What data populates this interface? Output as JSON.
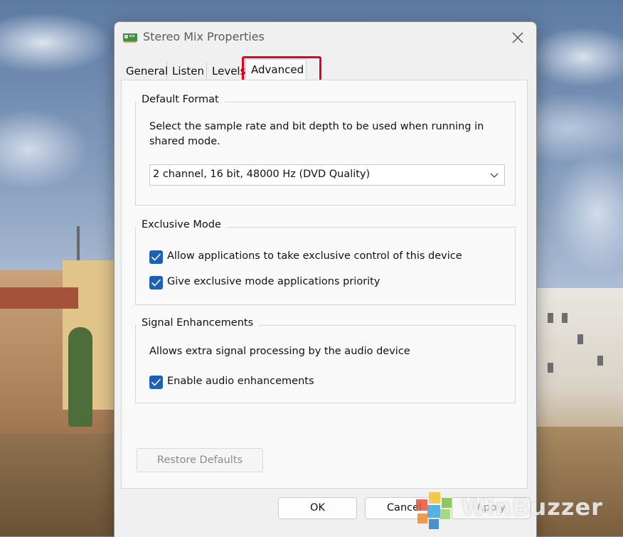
{
  "window": {
    "title": "Stereo Mix Properties",
    "title_icon": "sound-card-icon",
    "close_icon": "close-icon"
  },
  "tabs": [
    {
      "label": "General",
      "active": false
    },
    {
      "label": "Listen",
      "active": false
    },
    {
      "label": "Levels",
      "active": false
    },
    {
      "label": "Advanced",
      "active": true
    }
  ],
  "default_format": {
    "legend": "Default Format",
    "description": "Select the sample rate and bit depth to be used when running in shared mode.",
    "selected": "2 channel, 16 bit, 48000 Hz (DVD Quality)"
  },
  "exclusive_mode": {
    "legend": "Exclusive Mode",
    "options": [
      {
        "label": "Allow applications to take exclusive control of this device",
        "checked": true
      },
      {
        "label": "Give exclusive mode applications priority",
        "checked": true
      }
    ]
  },
  "signal_enhancements": {
    "legend": "Signal Enhancements",
    "description": "Allows extra signal processing by the audio device",
    "option": {
      "label": "Enable audio enhancements",
      "checked": true
    }
  },
  "buttons": {
    "restore": "Restore Defaults",
    "ok": "OK",
    "cancel": "Cancel",
    "apply": "Apply"
  },
  "watermark": {
    "text": "WinBuzzer"
  },
  "colors": {
    "accent": "#1f5fb4",
    "highlight": "#e8001c"
  }
}
